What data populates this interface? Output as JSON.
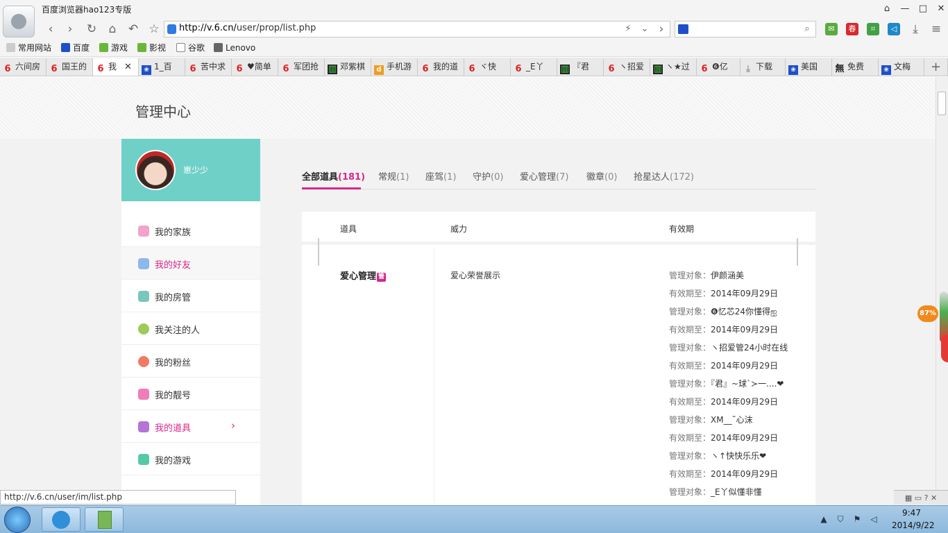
{
  "window": {
    "title": "百度浏览器hao123专版"
  },
  "nav": {
    "url_prefix": "http://v.6.cn/",
    "url_path": "user/prop/list.php"
  },
  "bookmarks": [
    "常用网站",
    "百度",
    "游戏",
    "影视",
    "谷歌",
    "Lenovo"
  ],
  "tabs": [
    "六间房",
    "国王的",
    "我",
    "1_百",
    "苦中求",
    "♥简单",
    "军团抢",
    "邓紫棋",
    "手机游",
    "我的道",
    "ヾ快",
    "_E丫",
    "『君",
    "ヽ招爱",
    "ヽ★过",
    "❻亿",
    "下载",
    "美国",
    "免费",
    "文梅"
  ],
  "page": {
    "title": "管理中心",
    "username": "崽少少",
    "sidebar": [
      "我的家族",
      "我的好友",
      "我的房管",
      "我关注的人",
      "我的粉丝",
      "我的靓号",
      "我的道具",
      "我的游戏"
    ],
    "content_tabs": [
      {
        "label": "全部道具",
        "count": "(181)"
      },
      {
        "label": "常规",
        "count": "(1)"
      },
      {
        "label": "座驾",
        "count": "(1)"
      },
      {
        "label": "守护",
        "count": "(0)"
      },
      {
        "label": "爱心管理",
        "count": "(7)"
      },
      {
        "label": "徽章",
        "count": "(0)"
      },
      {
        "label": "抢星达人",
        "count": "(172)"
      }
    ],
    "table_headers": [
      "道具",
      "威力",
      "有效期"
    ],
    "prop": {
      "name": "爱心管理",
      "badge": "管",
      "power": "爱心荣誉展示"
    },
    "validity": [
      {
        "k": "管理对象：",
        "v": "伊颜涵美"
      },
      {
        "k": "有效期至：",
        "v": "2014年09月29日"
      },
      {
        "k": "管理对象：",
        "v": "❻忆芯24你懂得ஐ"
      },
      {
        "k": "有效期至：",
        "v": "2014年09月29日"
      },
      {
        "k": "管理对象：",
        "v": "ヽ招爱管24小时在线"
      },
      {
        "k": "有效期至：",
        "v": "2014年09月29日"
      },
      {
        "k": "管理对象：",
        "v": "『君』~球`≻一....❤"
      },
      {
        "k": "有效期至：",
        "v": "2014年09月29日"
      },
      {
        "k": "管理对象：",
        "v": "XM__˜心沫"
      },
      {
        "k": "有效期至：",
        "v": "2014年09月29日"
      },
      {
        "k": "管理对象：",
        "v": "ヽ↑快快乐乐❤"
      },
      {
        "k": "有效期至：",
        "v": "2014年09月29日"
      },
      {
        "k": "管理对象：",
        "v": "_E丫似懂非懂"
      }
    ]
  },
  "speed": "87%",
  "status_url": "http://v.6.cn/user/im/list.php",
  "clock": {
    "time": "9:47",
    "date": "2014/9/22"
  }
}
